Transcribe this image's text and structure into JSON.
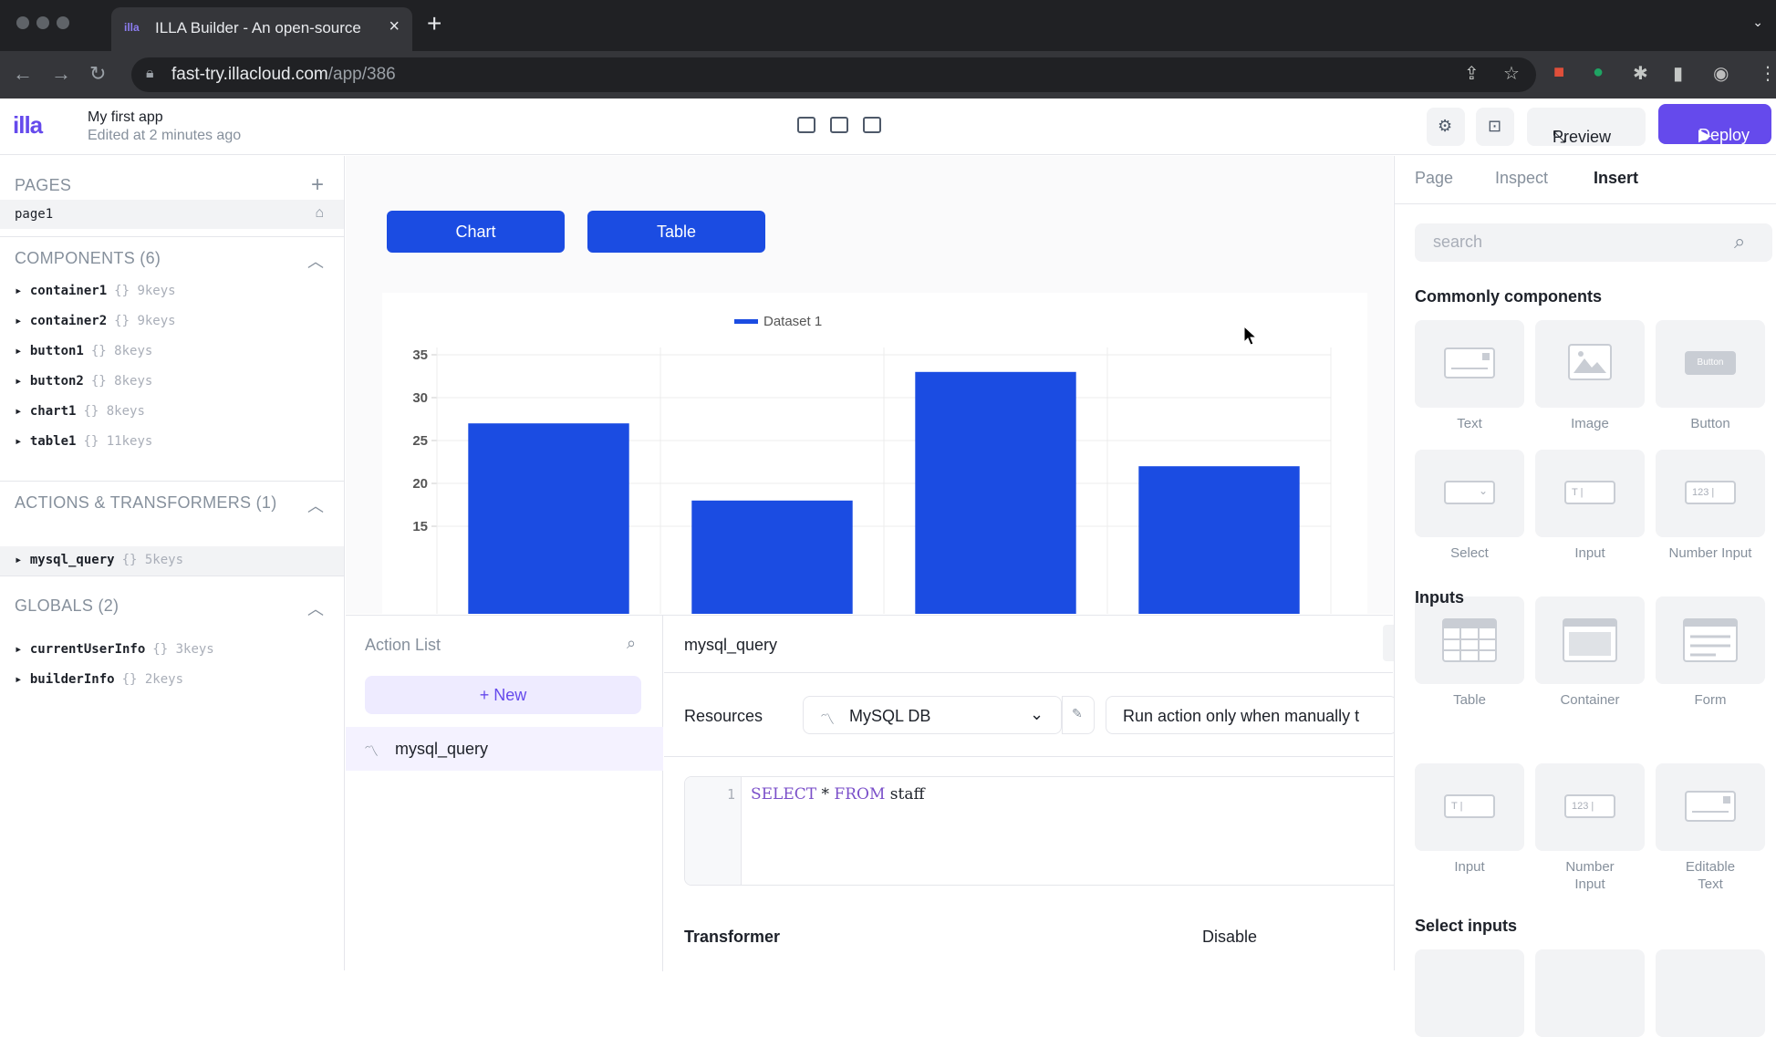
{
  "browser": {
    "tab_favicon": "illa",
    "tab_title": "ILLA Builder - An open-source",
    "url_host": "fast-try.illacloud.com",
    "url_path": "/app/386"
  },
  "header": {
    "logo": "illa",
    "app_name": "My first app",
    "edited": "Edited at 2 minutes ago",
    "preview_label": "Preview",
    "deploy_label": "Deploy"
  },
  "left_panel": {
    "pages_title": "PAGES",
    "pages": [
      "page1"
    ],
    "components_title": "COMPONENTS (6)",
    "components": [
      {
        "name": "container1",
        "meta": "{} 9keys"
      },
      {
        "name": "container2",
        "meta": "{} 9keys"
      },
      {
        "name": "button1",
        "meta": "{} 8keys"
      },
      {
        "name": "button2",
        "meta": "{} 8keys"
      },
      {
        "name": "chart1",
        "meta": "{} 8keys"
      },
      {
        "name": "table1",
        "meta": "{} 11keys"
      }
    ],
    "actions_title": "ACTIONS & TRANSFORMERS (1)",
    "actions": [
      {
        "name": "mysql_query",
        "meta": "{} 5keys"
      }
    ],
    "globals_title": "GLOBALS (2)",
    "globals": [
      {
        "name": "currentUserInfo",
        "meta": "{} 3keys"
      },
      {
        "name": "builderInfo",
        "meta": "{} 2keys"
      }
    ]
  },
  "canvas": {
    "chart_button_label": "Chart",
    "table_button_label": "Table"
  },
  "chart_data": {
    "type": "bar",
    "legend": [
      "Dataset 1"
    ],
    "legend_position": "top-center",
    "series": [
      {
        "name": "Dataset 1",
        "values": [
          27,
          18,
          33,
          22
        ]
      }
    ],
    "y_ticks": [
      15,
      20,
      25,
      30,
      35
    ],
    "ylim": [
      12.5,
      35
    ],
    "grid": true,
    "color": "#1b4ce2"
  },
  "action_panel": {
    "list_title": "Action List",
    "new_label": "+ New",
    "items": [
      "mysql_query"
    ],
    "editor_title": "mysql_query",
    "resources_label": "Resources",
    "resource_value": "MySQL DB",
    "run_mode": "Run action only when manually t",
    "code_line_number": "1",
    "code_kw1": "SELECT",
    "code_mid": " * ",
    "code_kw2": "FROM",
    "code_rest": " staff",
    "transformer_label": "Transformer",
    "transformer_state": "Disable"
  },
  "right_panel": {
    "tabs": [
      "Page",
      "Inspect",
      "Insert"
    ],
    "active_tab": "Insert",
    "search_placeholder": "search",
    "common_title": "Commonly components",
    "common": [
      "Text",
      "Image",
      "Button",
      "Select",
      "Input",
      "Number Input",
      "Table",
      "Container",
      "Form"
    ],
    "button_glyph_text": "Button",
    "inputs_title": "Inputs",
    "inputs": [
      "Input",
      "Number Input",
      "Editable Text"
    ],
    "select_inputs_title": "Select inputs",
    "glyph_input": "T |",
    "glyph_number": "123 |"
  },
  "colors": {
    "accent": "#654aec",
    "chart_blue": "#1b4ce2"
  }
}
